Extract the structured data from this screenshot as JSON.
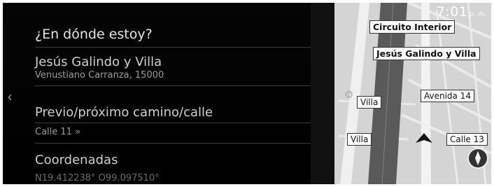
{
  "status": {
    "time": "7:01",
    "ampm": "p. m."
  },
  "panel": {
    "title": "¿En dónde estoy?",
    "street": "Jesús Galindo y Villa",
    "locality": "Venustiano Carranza, 15000",
    "prev_next_label": "Previo/próximo camino/calle",
    "next_street": "Calle 11 »",
    "coords_label": "Coordenadas",
    "coords_value": "N19.412238° O99.097510°"
  },
  "map": {
    "labels": {
      "circuito": "Circuito Interior",
      "galindo": "Jesús Galindo y Villa",
      "avenida14": "Avenida 14",
      "villa1": "Villa",
      "villa2": "Villa",
      "calle13": "Calle 13"
    }
  },
  "icons": [
    "chevron-left-icon",
    "chevron-right-icon",
    "gear-icon",
    "compass-icon",
    "position-arrow-icon"
  ]
}
